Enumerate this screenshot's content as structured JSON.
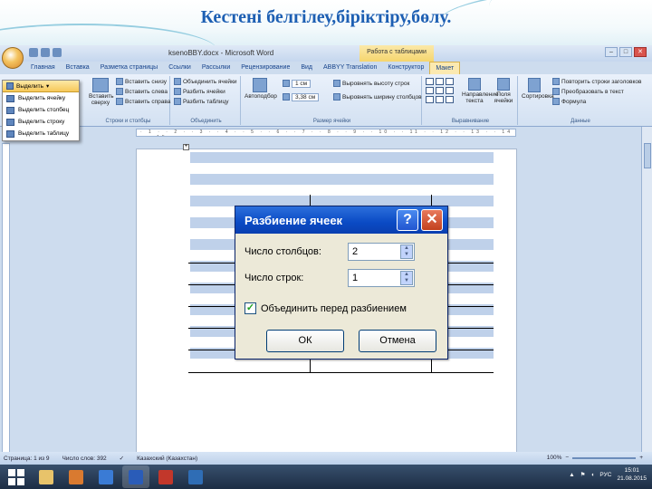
{
  "slide": {
    "title": "Кестені белгілеу,біріктіру,бөлу."
  },
  "window": {
    "doc_title": "ksenoBBY.docx - Microsoft Word",
    "context_tab": "Работа с таблицами",
    "controls": [
      "–",
      "□",
      "✕"
    ]
  },
  "tabs": [
    "Главная",
    "Вставка",
    "Разметка страницы",
    "Ссылки",
    "Рассылки",
    "Рецензирование",
    "Вид",
    "ABBYY Translation",
    "Конструктор",
    "Макет"
  ],
  "active_tab_index": 9,
  "ribbon": {
    "select_button": "Выделить",
    "select_menu": [
      "Выделить ячейку",
      "Выделить столбец",
      "Выделить строку",
      "Выделить таблицу"
    ],
    "rows_cols": {
      "main_label": "Вставить сверху",
      "items": [
        "Вставить снизу",
        "Вставить слева",
        "Вставить справа"
      ],
      "group_label": "Строки и столбцы"
    },
    "merge": {
      "items": [
        "Объединить ячейки",
        "Разбить ячейки",
        "Разбить таблицу"
      ],
      "group_label": "Объединить"
    },
    "cellsize": {
      "autofit": "Автоподбор",
      "height": "1 см",
      "width": "3,38 см",
      "items": [
        "Выровнять высоту строк",
        "Выровнять ширину столбцов"
      ],
      "group_label": "Размер ячейки"
    },
    "align": {
      "text_dir": "Направление текста",
      "margins": "Поля ячейки",
      "group_label": "Выравнивание"
    },
    "data": {
      "sort": "Сортировка",
      "items": [
        "Повторить строки заголовков",
        "Преобразовать в текст",
        "Формула"
      ],
      "group_label": "Данные"
    }
  },
  "dialog": {
    "title": "Разбиение ячеек",
    "cols_label": "Число столбцов:",
    "cols_value": "2",
    "rows_label": "Число строк:",
    "rows_value": "1",
    "merge_label": "Объединить перед разбиением",
    "merge_checked": true,
    "ok": "ОК",
    "cancel": "Отмена",
    "help": "?",
    "close": "✕"
  },
  "status": {
    "page": "Страница: 1 из 9",
    "words": "Число слов: 392",
    "lang": "Казахский (Казахстан)",
    "zoom": "100%"
  },
  "taskbar": {
    "lang": "РУС",
    "time": "15:01",
    "date": "21.08.2015",
    "icon_colors": [
      "#e8c36a",
      "#d97a30",
      "#3a7bd5",
      "#2a5cb8",
      "#c2372b",
      "#2f6db5"
    ]
  }
}
